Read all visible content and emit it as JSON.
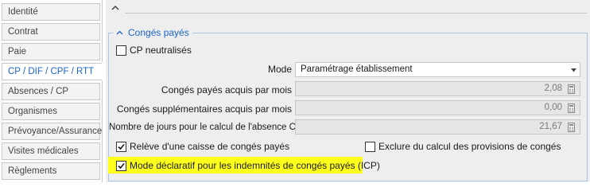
{
  "sidebar": {
    "tabs": [
      {
        "label": "Identité"
      },
      {
        "label": "Contrat"
      },
      {
        "label": "Paie"
      },
      {
        "label": "CP / DIF / CPF / RTT",
        "active": true
      },
      {
        "label": "Absences / CP"
      },
      {
        "label": "Organismes"
      },
      {
        "label": "Prévoyance/Assurance"
      },
      {
        "label": "Visites médicales"
      },
      {
        "label": "Règlements"
      }
    ]
  },
  "group": {
    "title": "Congés payés"
  },
  "form": {
    "cp_neutralises": {
      "label": "CP neutralisés",
      "checked": false
    },
    "mode": {
      "label": "Mode",
      "value": "Paramétrage établissement"
    },
    "cp_acquis": {
      "label": "Congés payés acquis par mois",
      "value": "2,08"
    },
    "cs_acquis": {
      "label": "Congés supplémentaires acquis par mois",
      "value": "0,00"
    },
    "nb_jours": {
      "label": "Nombre de jours pour le calcul de l'absence CP",
      "value": "21,67"
    },
    "releve": {
      "label": "Relève d'une caisse de congés payés",
      "checked": true
    },
    "exclure": {
      "label": "Exclure du calcul des provisions de congés",
      "checked": false
    },
    "declaratif": {
      "label": "Mode déclaratif pour les indemnités de congés payés (ICP)",
      "checked": true
    }
  },
  "colors": {
    "accent": "#1b65c4",
    "highlight": "#ffff1e",
    "panel": "#eeeeee"
  }
}
